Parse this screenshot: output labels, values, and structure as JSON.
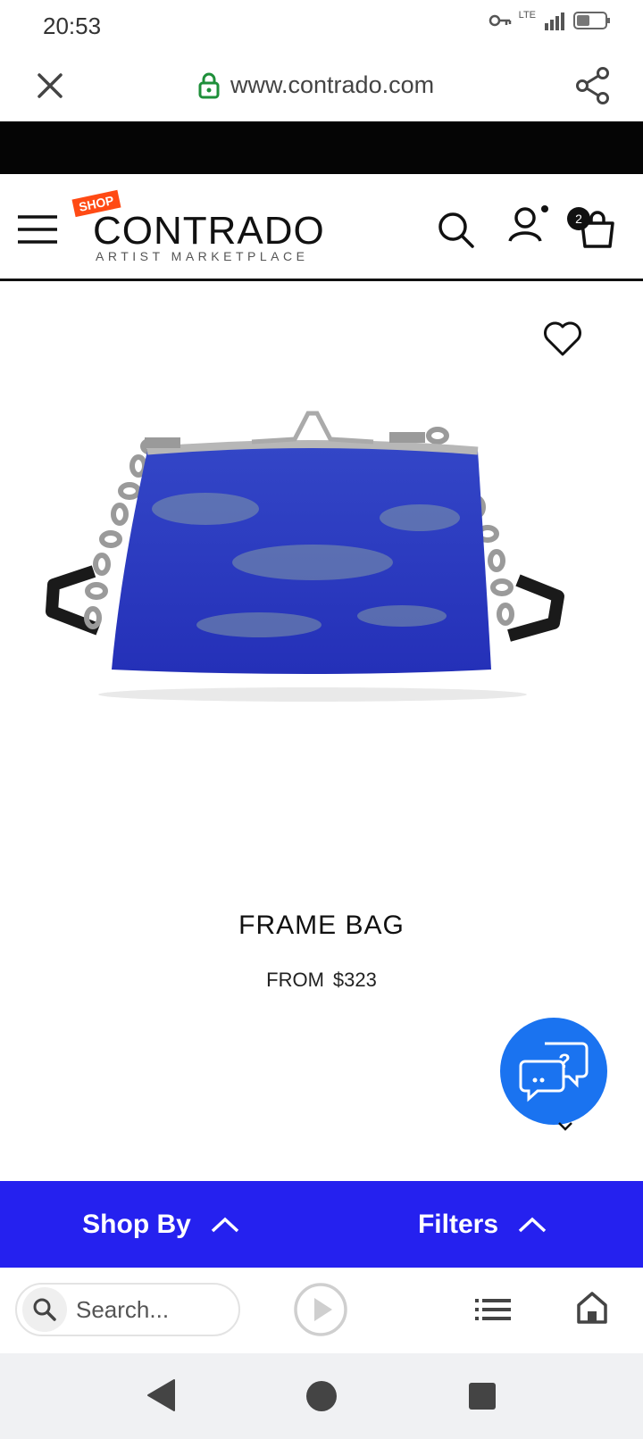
{
  "status_bar": {
    "time": "20:53",
    "network": "LTE",
    "sim_slot": "1"
  },
  "browser": {
    "url": "www.contrado.com"
  },
  "site": {
    "logo_badge": "SHOP",
    "logo_name": "CONTRADO",
    "logo_tagline": "ARTIST MARKETPLACE",
    "cart_count": "2"
  },
  "product": {
    "title": "FRAME BAG",
    "price_prefix": "FROM",
    "price": "$323",
    "bag_color": "#2b3fcf"
  },
  "filter_bar": {
    "shop_by_label": "Shop By",
    "filters_label": "Filters",
    "color": "#2521ef"
  },
  "toolbar": {
    "search_placeholder": "Search..."
  },
  "colors": {
    "accent_blue": "#1a73f0",
    "logo_orange": "#ff4a14"
  }
}
